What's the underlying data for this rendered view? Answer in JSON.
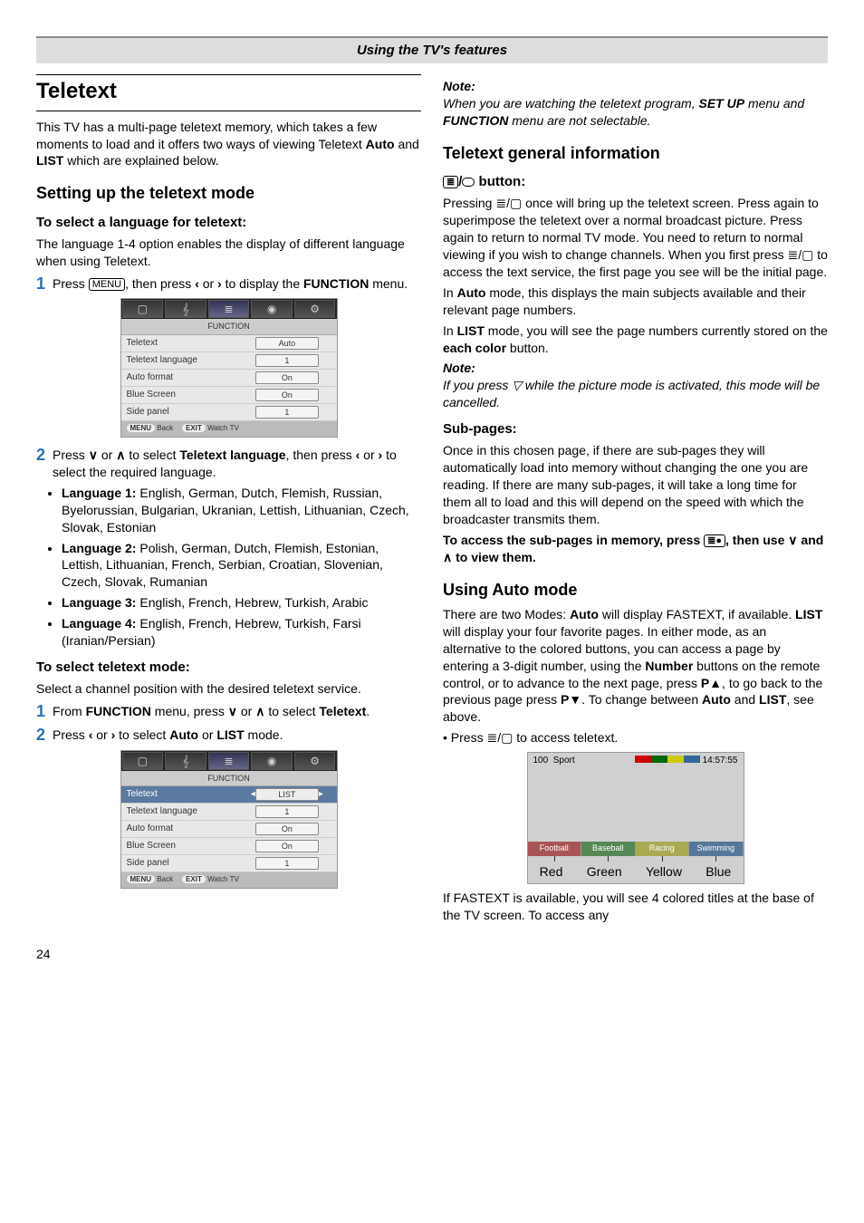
{
  "top_bar": "Using the TV's features",
  "left": {
    "title": "Teletext",
    "intro": "This TV has a multi-page teletext memory, which takes a few moments to load and it offers two ways of viewing Teletext Auto and LIST which are explained below.",
    "intro_bold1": "Auto",
    "intro_bold2": "LIST",
    "h2_setting": "Setting up the teletext mode",
    "h3_lang": "To select a language for teletext:",
    "lang_desc": "The language 1-4 option enables the display of different language when using Teletext.",
    "step1_a": "Press ",
    "step1_menu": "MENU",
    "step1_b": ", then press ",
    "step1_c": " or ",
    "step1_d": " to display the ",
    "step1_func": "FUNCTION",
    "step1_e": " menu.",
    "step2_a": "Press ",
    "step2_b": " or ",
    "step2_c": " to select ",
    "step2_bold": "Teletext language",
    "step2_d": ", then press ",
    "step2_e": " or ",
    "step2_f": " to select the required language.",
    "langs": [
      {
        "label": "Language 1:",
        "text": " English, German, Dutch, Flemish, Russian, Byelorussian, Bulgarian, Ukranian, Lettish, Lithuanian, Czech, Slovak, Estonian"
      },
      {
        "label": "Language 2:",
        "text": " Polish, German, Dutch, Flemish, Estonian, Lettish, Lithuanian, French, Serbian, Croatian, Slovenian, Czech, Slovak, Rumanian"
      },
      {
        "label": "Language 3:",
        "text": " English, French, Hebrew, Turkish, Arabic"
      },
      {
        "label": "Language 4:",
        "text": " English, French, Hebrew, Turkish, Farsi (Iranian/Persian)"
      }
    ],
    "h3_mode": "To select teletext mode:",
    "mode_desc": "Select a channel position with the desired teletext service.",
    "mstep1_a": "From ",
    "mstep1_func": "FUNCTION",
    "mstep1_b": " menu, press ",
    "mstep1_c": " or ",
    "mstep1_d": " to select ",
    "mstep1_bold": "Teletext",
    "mstep1_e": ".",
    "mstep2_a": "Press ",
    "mstep2_b": " or ",
    "mstep2_c": " to select ",
    "mstep2_auto": "Auto",
    "mstep2_d": " or ",
    "mstep2_list": "LIST",
    "mstep2_e": " mode.",
    "osd1": {
      "title": "FUNCTION",
      "rows": [
        {
          "l": "Teletext",
          "r": "Auto"
        },
        {
          "l": "Teletext language",
          "r": "1"
        },
        {
          "l": "Auto format",
          "r": "On"
        },
        {
          "l": "Blue Screen",
          "r": "On"
        },
        {
          "l": "Side panel",
          "r": "1"
        }
      ],
      "back": "Back",
      "watch": "Watch TV",
      "menu_pill": "MENU",
      "exit_pill": "EXIT"
    },
    "osd2": {
      "title": "FUNCTION",
      "rows": [
        {
          "l": "Teletext",
          "r": "LIST",
          "hl": true
        },
        {
          "l": "Teletext language",
          "r": "1"
        },
        {
          "l": "Auto format",
          "r": "On"
        },
        {
          "l": "Blue Screen",
          "r": "On"
        },
        {
          "l": "Side panel",
          "r": "1"
        }
      ],
      "back": "Back",
      "watch": "Watch TV",
      "menu_pill": "MENU",
      "exit_pill": "EXIT"
    }
  },
  "right": {
    "note_label": "Note:",
    "note1_a": "When you are watching the teletext program, ",
    "note1_b": "SET UP",
    "note1_c": " menu and ",
    "note1_d": "FUNCTION",
    "note1_e": " menu are not selectable.",
    "h2_general": "Teletext general information",
    "h3_button": " button:",
    "btn_p1": "Pressing ≣/▢ once will bring up the teletext screen. Press again to superimpose the teletext over a normal broadcast picture. Press again to return to normal TV mode. You need to return to normal viewing if you wish to change channels. When you first press ≣/▢ to access the text service, the first page you see will be the initial page.",
    "btn_p2_a": "In ",
    "btn_auto": "Auto",
    "btn_p2_b": " mode, this displays the main subjects available and their relevant page numbers.",
    "btn_p3_a": "In ",
    "btn_list": "LIST",
    "btn_p3_b": " mode, you will see the page numbers currently stored on the ",
    "btn_each": "each color",
    "btn_p3_c": " button.",
    "note2_label": "Note:",
    "note2_text": "If you press ▽ while the picture mode is activated, this mode will be cancelled.",
    "h3_sub": "Sub-pages:",
    "sub_p1": "Once in this chosen page, if there are sub-pages they will automatically load into memory without changing the one you are reading. If there are many sub-pages, it will take a long time for them all to load and this will depend on the speed with which the broadcaster transmits them.",
    "sub_bold_a": "To access the sub-pages in memory, press ",
    "sub_bold_b": ", then use ",
    "sub_bold_c": " and ",
    "sub_bold_d": " to view them.",
    "h2_auto": "Using Auto mode",
    "auto_p1_a": "There are two Modes: ",
    "auto_bold1": "Auto",
    "auto_p1_b": " will display FASTEXT, if available. ",
    "auto_bold2": "LIST",
    "auto_p1_c": " will display your four favorite pages. In either mode, as an alternative to the colored buttons, you can access a page by entering a 3-digit number, using the ",
    "auto_bold3": "Number",
    "auto_p1_d": " buttons on the remote control, or to advance to the next page, press ",
    "auto_bold4": "P▲",
    "auto_p1_e": ", to go back to the previous page press ",
    "auto_bold5": "P▼",
    "auto_p1_f": ". To change between ",
    "auto_bold6": "Auto",
    "auto_p1_g": " and ",
    "auto_bold7": "LIST",
    "auto_p1_h": ", see above.",
    "auto_bullet": "Press ≣/▢ to access teletext.",
    "ttx": {
      "ch": "100",
      "title": "Sport",
      "time": "14:57:55",
      "btns": [
        "Football",
        "Baseball",
        "Racing",
        "Swimming"
      ],
      "labels": [
        "Red",
        "Green",
        "Yellow",
        "Blue"
      ]
    },
    "auto_p2": "If FASTEXT is available, you will see 4 colored titles at the base of the TV screen. To access any"
  },
  "page_number": "24",
  "icons": {
    "left": "‹",
    "right": "›",
    "up": "∧",
    "down": "∨",
    "ttx": "≣",
    "box": "▢",
    "sub": "≣●"
  }
}
